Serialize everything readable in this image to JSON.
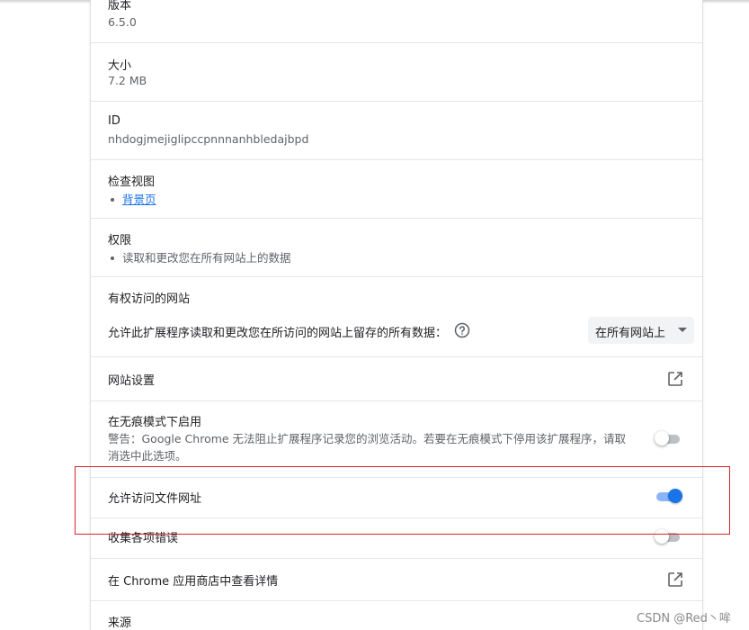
{
  "details": {
    "version": {
      "label": "版本",
      "value": "6.5.0"
    },
    "size": {
      "label": "大小",
      "value": "7.2 MB"
    },
    "id": {
      "label": "ID",
      "value": "nhdogjmejiglipccpnnnanhbledajbpd"
    },
    "inspect_views": {
      "label": "检查视图",
      "items": [
        "背景页"
      ]
    },
    "permissions": {
      "label": "权限",
      "items": [
        "读取和更改您在所有网站上的数据"
      ]
    },
    "site_access": {
      "label": "有权访问的网站",
      "description": "允许此扩展程序读取和更改您在所访问的网站上留存的所有数据：",
      "selected": "在所有网站上"
    },
    "site_settings": {
      "label": "网站设置"
    },
    "incognito": {
      "label": "在无痕模式下启用",
      "warning": "警告：Google Chrome 无法阻止扩展程序记录您的浏览活动。若要在无痕模式下停用该扩展程序，请取消选中此选项。",
      "enabled": false
    },
    "file_urls": {
      "label": "允许访问文件网址",
      "enabled": true
    },
    "collect_errors": {
      "label": "收集各项错误",
      "enabled": false
    },
    "webstore": {
      "label": "在 Chrome 应用商店中查看详情"
    },
    "source": {
      "label": "来源"
    }
  },
  "watermark": "CSDN @Red丶哞",
  "colors": {
    "accent": "#1a73e8",
    "highlight": "#d9232a"
  },
  "icons": {
    "help": "help-circle-icon",
    "external": "open-in-new-icon"
  }
}
